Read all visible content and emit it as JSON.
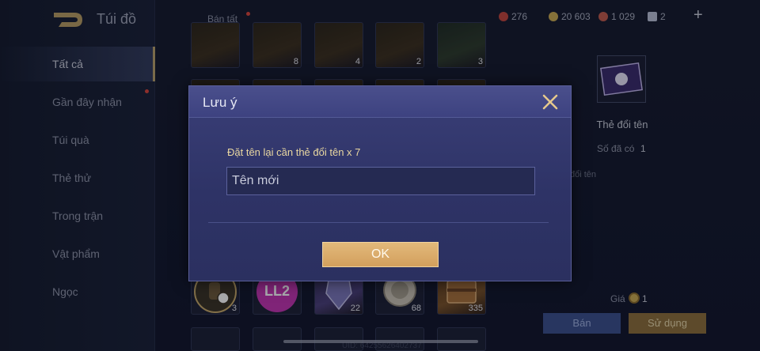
{
  "app": {
    "title": "Túi đồ",
    "sell_all_label": "Bán tất"
  },
  "sidebar": {
    "items": [
      {
        "label": "Tất cả",
        "active": true
      },
      {
        "label": "Gần đây nhận",
        "badge": true
      },
      {
        "label": "Túi quà"
      },
      {
        "label": "Thẻ thử"
      },
      {
        "label": "Trong trận"
      },
      {
        "label": "Vật phẩm"
      },
      {
        "label": "Ngọc"
      }
    ]
  },
  "currencies": [
    {
      "icon": "red-gem-icon",
      "value": "276",
      "color": "#c0443b"
    },
    {
      "icon": "gold-coin-icon",
      "value": "20 603",
      "color": "#c9a94f"
    },
    {
      "icon": "ruby-icon",
      "value": "1 029",
      "color": "#c05a4b"
    },
    {
      "icon": "ticket-icon",
      "value": "2",
      "color": "#b9bfd4"
    }
  ],
  "grid": {
    "top_row_counts": [
      "",
      "8",
      "4",
      "2",
      "3"
    ],
    "bottom_row": [
      {
        "icon": "hand-badge-icon",
        "count": "3"
      },
      {
        "icon": "ll2-badge-icon",
        "label": "LL2",
        "count": ""
      },
      {
        "icon": "armor-icon",
        "count": "22"
      },
      {
        "icon": "medal-icon",
        "count": "68"
      },
      {
        "icon": "chest-icon",
        "count": "335"
      }
    ]
  },
  "detail": {
    "item_name": "Thẻ đổi tên",
    "owned_label": "Số đã có",
    "owned_value": "1",
    "description_tail": "đổi tên",
    "price_label": "Giá",
    "price_value": "1",
    "sell_label": "Bán",
    "use_label": "Sử dụng"
  },
  "footer": {
    "uid_text": "UID: 64255626402737"
  },
  "modal": {
    "title": "Lưu ý",
    "message": "Đặt tên lại cần thẻ đổi tên x 7",
    "input_placeholder": "Tên mới",
    "ok_label": "OK"
  },
  "colors": {
    "accent_gold": "#d39f5d",
    "modal_bg": "#2e3366",
    "message_text": "#e9d7a1"
  }
}
